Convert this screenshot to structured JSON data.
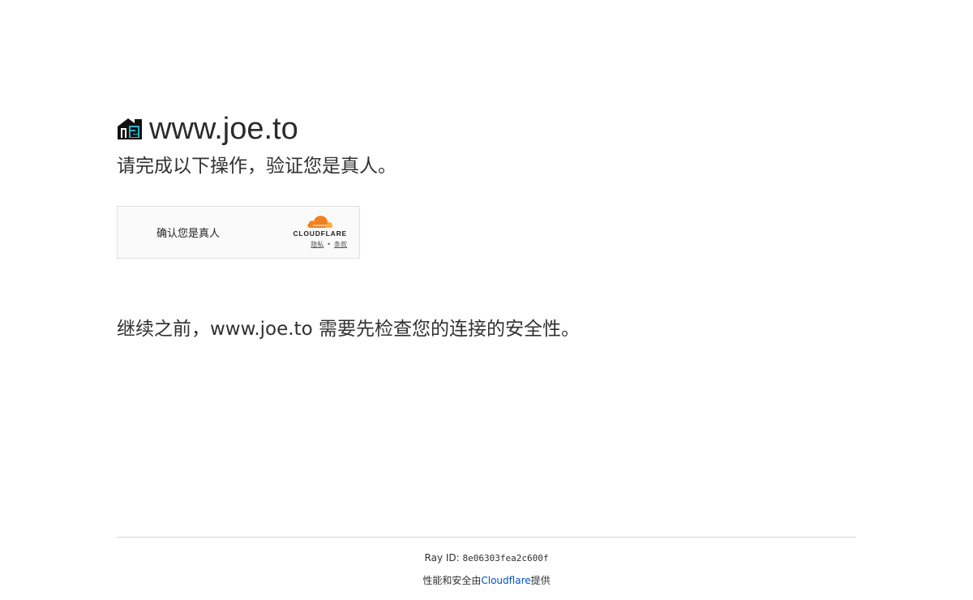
{
  "site": {
    "name": "www.joe.to",
    "favicon_icon": "joe-logo-icon",
    "subtitle": "请完成以下操作，验证您是真人。"
  },
  "widget": {
    "label": "确认您是真人",
    "brand_word": "CLOUDFLARE",
    "privacy_link": "隐私",
    "separator": "•",
    "terms_link": "条款",
    "brand_color": "#f38020"
  },
  "description": "继续之前，www.joe.to 需要先检查您的连接的安全性。",
  "footer": {
    "ray_label": "Ray ID:",
    "ray_value": "8e06303fea2c600f",
    "powered_prefix": "性能和安全由",
    "powered_link": "Cloudflare",
    "powered_suffix": "提供",
    "link_color": "#0051c3"
  }
}
